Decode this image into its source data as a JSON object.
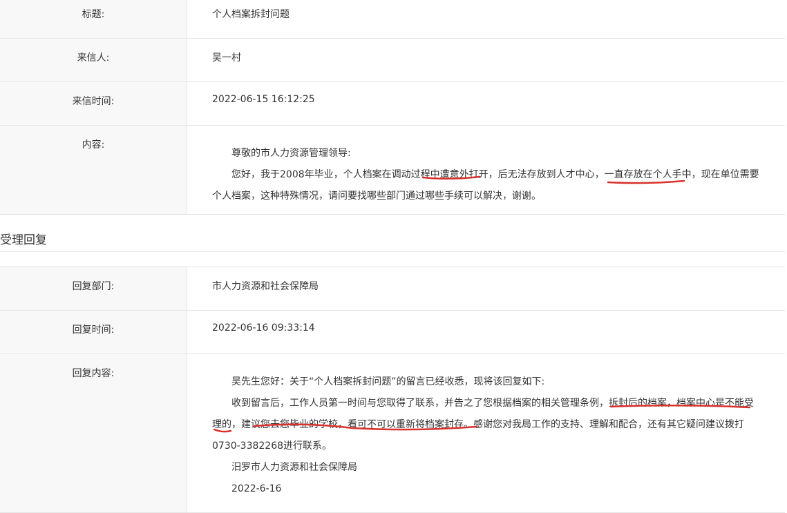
{
  "letter": {
    "title_label": "标题:",
    "title_value": "个人档案拆封问题",
    "sender_label": "来信人:",
    "sender_value": "吴一村",
    "time_label": "来信时间:",
    "time_value": "2022-06-15 16:12:25",
    "content_label": "内容:",
    "content_p1": "尊敬的市人力资源管理领导:",
    "content_p2": "您好，我于2008年毕业，个人档案在调动过程中遭意外打开，后无法存放到人才中心，一直存放在个人手中，现在单位需要个人档案，这种特殊情况，请问要找哪些部门通过哪些手续可以解决，谢谢。"
  },
  "reply_section_title": "受理回复",
  "reply": {
    "dept_label": "回复部门:",
    "dept_value": "市人力资源和社会保障局",
    "time_label": "回复时间:",
    "time_value": "2022-06-16 09:33:14",
    "content_label": "回复内容:",
    "content_p1": "吴先生您好：关于“个人档案拆封问题”的留言已经收悉，现将该回复如下:",
    "content_p2": "收到留言后，工作人员第一时间与您取得了联系，并告之了您根据档案的相关管理条例，拆封后的档案，档案中心是不能受理的，建议您去您毕业的学校，看可不可以重新将档案封存。感谢您对我局工作的支持、理解和配合，还有其它疑问建议拨打0730-3382268进行联系。",
    "signature": "汨罗市人力资源和社会保障局",
    "date": "2022-6-16"
  },
  "annotation_color": "#d9302c"
}
